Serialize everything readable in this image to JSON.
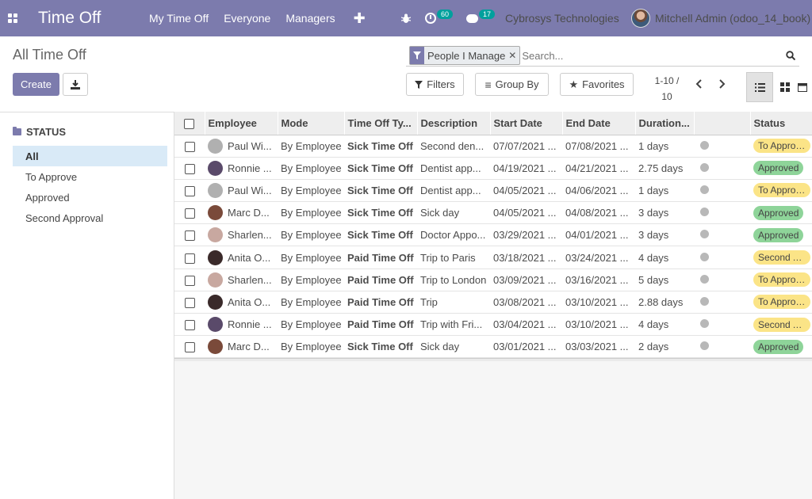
{
  "navbar": {
    "app_title": "Time Off",
    "menu": [
      "My Time Off",
      "Everyone",
      "Managers"
    ],
    "activity_count": "60",
    "messages_count": "17",
    "company": "Cybrosys Technologies",
    "user": "Mitchell Admin (odoo_14_book)",
    "bg_color": "#7c7bad"
  },
  "control_panel": {
    "breadcrumb": "All Time Off",
    "create_label": "Create",
    "facet_label": "People I Manage",
    "search_placeholder": "Search...",
    "filters_label": "Filters",
    "groupby_label": "Group By",
    "favorites_label": "Favorites",
    "pager_line1": "1-10 /",
    "pager_line2": "10"
  },
  "search_panel": {
    "header": "STATUS",
    "items": [
      "All",
      "To Approve",
      "Approved",
      "Second Approval"
    ],
    "active": "All"
  },
  "table": {
    "columns": [
      "Employee",
      "Mode",
      "Time Off Ty...",
      "Description",
      "Start Date",
      "End Date",
      "Duration...",
      "",
      "Status"
    ],
    "rows": [
      {
        "employee": "Paul Wi...",
        "mode": "By Employee",
        "type": "Sick Time Off",
        "description": "Second den...",
        "start": "07/07/2021 ...",
        "end": "07/08/2021 ...",
        "duration": "1 days",
        "status": "To Approve",
        "status_kind": "approve",
        "avatar": "#b0b0b0"
      },
      {
        "employee": "Ronnie ...",
        "mode": "By Employee",
        "type": "Sick Time Off",
        "description": "Dentist app...",
        "start": "04/19/2021 ...",
        "end": "04/21/2021 ...",
        "duration": "2.75 days",
        "status": "Approved",
        "status_kind": "approved",
        "avatar": "#5a4a6a"
      },
      {
        "employee": "Paul Wi...",
        "mode": "By Employee",
        "type": "Sick Time Off",
        "description": "Dentist app...",
        "start": "04/05/2021 ...",
        "end": "04/06/2021 ...",
        "duration": "1 days",
        "status": "To Approve",
        "status_kind": "approve",
        "avatar": "#b0b0b0"
      },
      {
        "employee": "Marc D...",
        "mode": "By Employee",
        "type": "Sick Time Off",
        "description": "Sick day",
        "start": "04/05/2021 ...",
        "end": "04/08/2021 ...",
        "duration": "3 days",
        "status": "Approved",
        "status_kind": "approved",
        "avatar": "#7a4a3a"
      },
      {
        "employee": "Sharlen...",
        "mode": "By Employee",
        "type": "Sick Time Off",
        "description": "Doctor Appo...",
        "start": "03/29/2021 ...",
        "end": "04/01/2021 ...",
        "duration": "3 days",
        "status": "Approved",
        "status_kind": "approved",
        "avatar": "#c8a8a0"
      },
      {
        "employee": "Anita O...",
        "mode": "By Employee",
        "type": "Paid Time Off",
        "description": "Trip to Paris",
        "start": "03/18/2021 ...",
        "end": "03/24/2021 ...",
        "duration": "4 days",
        "status": "Second Ap...",
        "status_kind": "second",
        "avatar": "#3a2a2a"
      },
      {
        "employee": "Sharlen...",
        "mode": "By Employee",
        "type": "Paid Time Off",
        "description": "Trip to London",
        "start": "03/09/2021 ...",
        "end": "03/16/2021 ...",
        "duration": "5 days",
        "status": "To Approve",
        "status_kind": "approve",
        "avatar": "#c8a8a0"
      },
      {
        "employee": "Anita O...",
        "mode": "By Employee",
        "type": "Paid Time Off",
        "description": "Trip",
        "start": "03/08/2021 ...",
        "end": "03/10/2021 ...",
        "duration": "2.88 days",
        "status": "To Approve",
        "status_kind": "approve",
        "avatar": "#3a2a2a"
      },
      {
        "employee": "Ronnie ...",
        "mode": "By Employee",
        "type": "Paid Time Off",
        "description": "Trip with Fri...",
        "start": "03/04/2021 ...",
        "end": "03/10/2021 ...",
        "duration": "4 days",
        "status": "Second Ap...",
        "status_kind": "second",
        "avatar": "#5a4a6a"
      },
      {
        "employee": "Marc D...",
        "mode": "By Employee",
        "type": "Sick Time Off",
        "description": "Sick day",
        "start": "03/01/2021 ...",
        "end": "03/03/2021 ...",
        "duration": "2 days",
        "status": "Approved",
        "status_kind": "approved",
        "avatar": "#7a4a3a"
      }
    ]
  }
}
